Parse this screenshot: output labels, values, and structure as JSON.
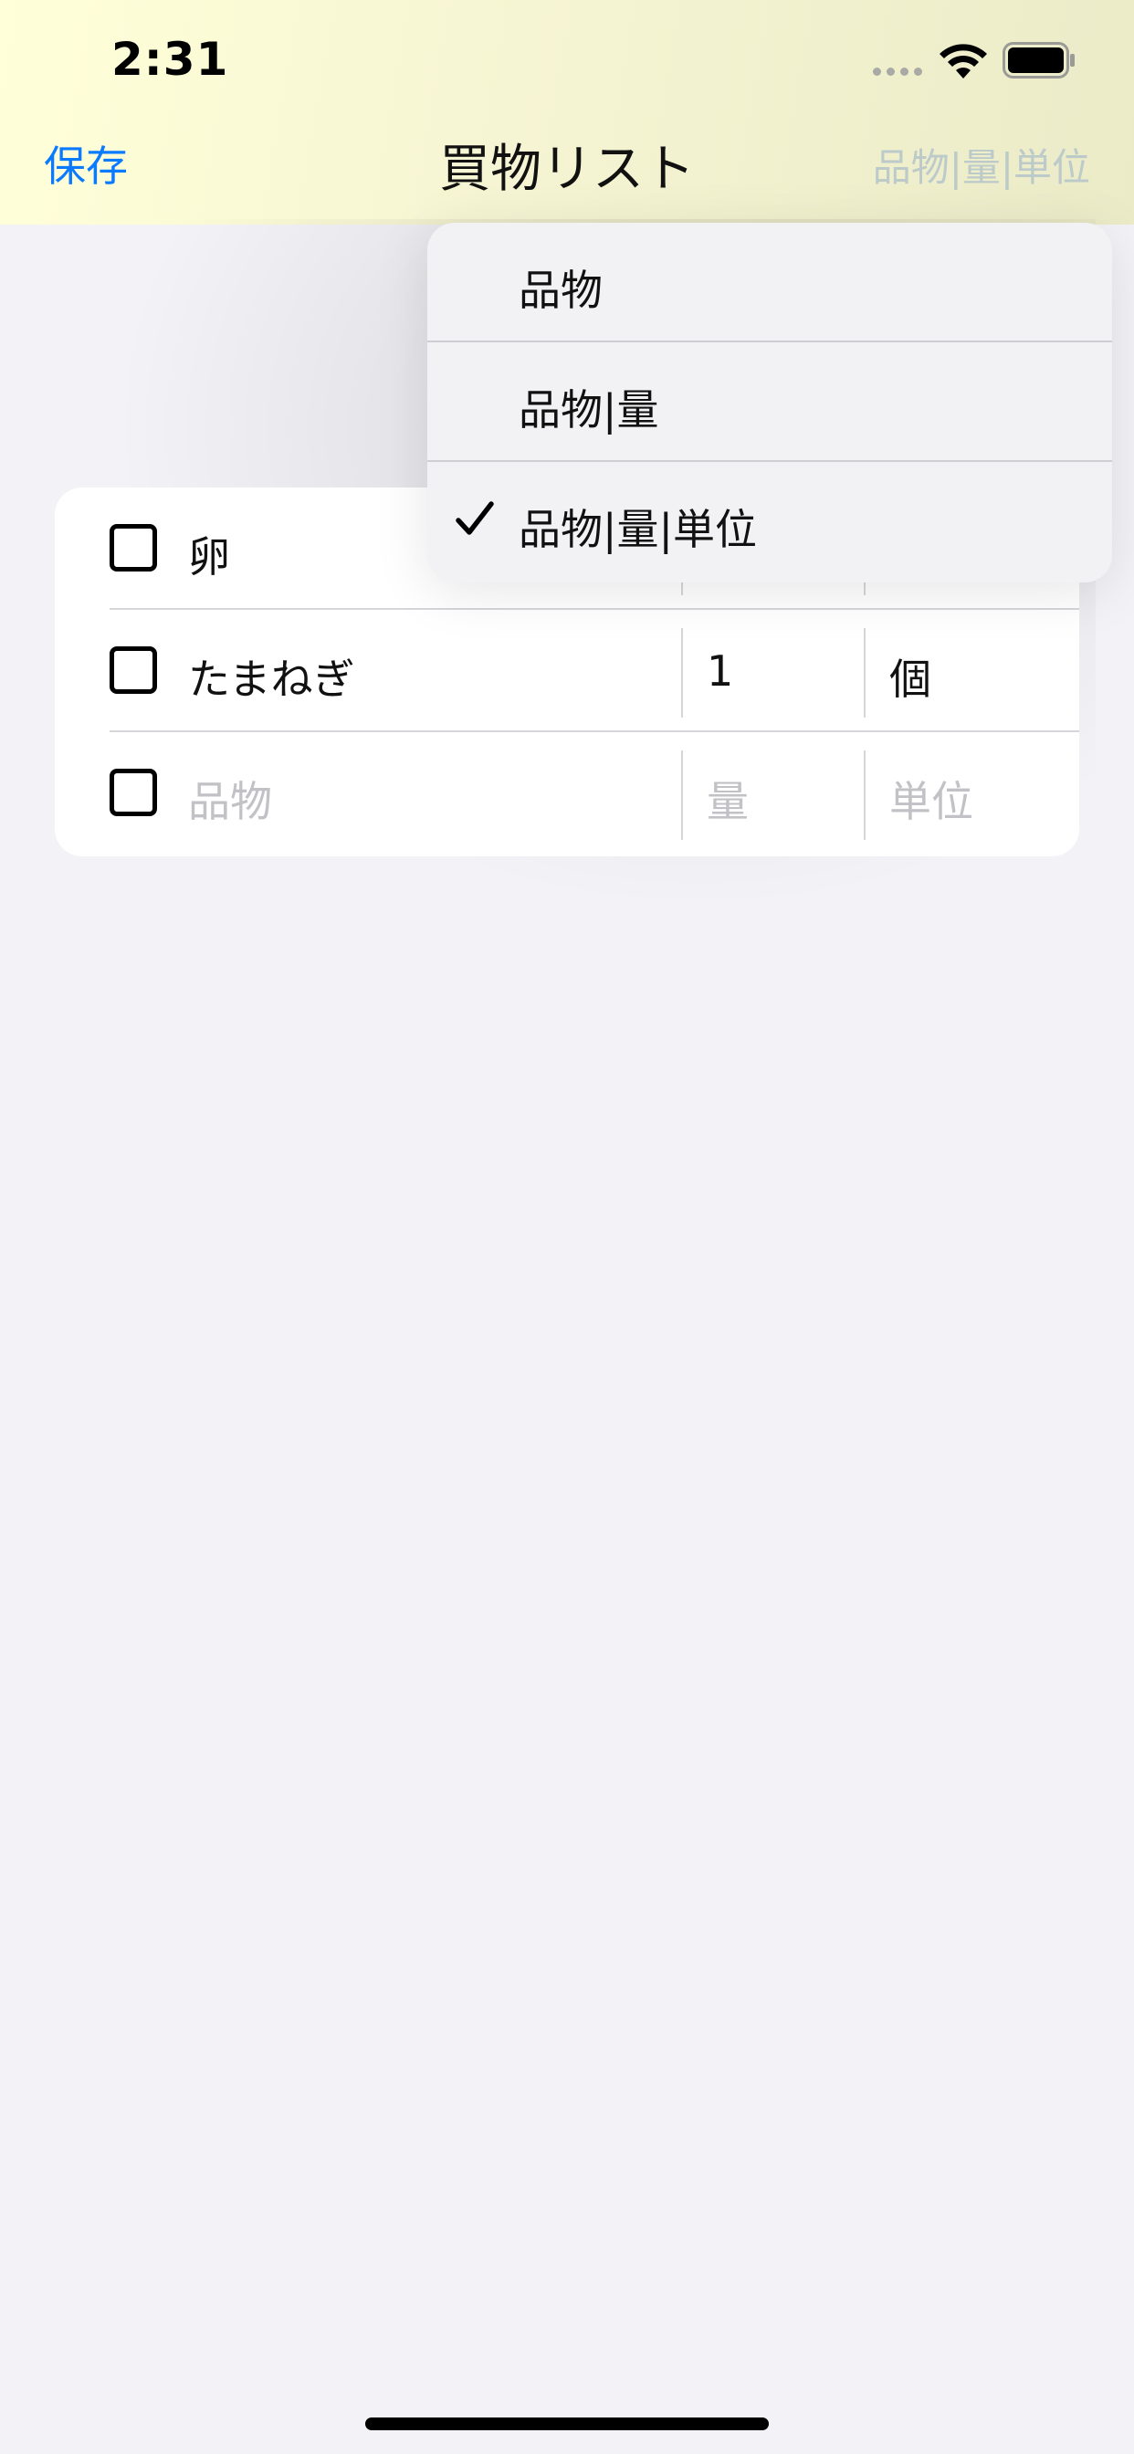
{
  "status_bar": {
    "time": "2:31",
    "icons": [
      "signal-icon",
      "wifi-icon",
      "battery-icon"
    ]
  },
  "nav": {
    "save_label": "保存",
    "title": "買物リスト",
    "right_label": "品物|量|単位"
  },
  "list": {
    "rows": [
      {
        "checked": false,
        "name": "卵",
        "qty": "",
        "unit": ""
      },
      {
        "checked": false,
        "name": "たまねぎ",
        "qty": "1",
        "unit": "個"
      }
    ],
    "new_row": {
      "name_placeholder": "品物",
      "qty_placeholder": "量",
      "unit_placeholder": "単位"
    }
  },
  "menu": {
    "items": [
      {
        "label": "品物",
        "selected": false
      },
      {
        "label": "品物|量",
        "selected": false
      },
      {
        "label": "品物|量|単位",
        "selected": true
      }
    ]
  },
  "colors": {
    "accent": "#0a7aff",
    "header_gradient_start": "#ffffd9",
    "header_gradient_end": "#ebebc8",
    "background": "#f2f2f7",
    "placeholder": "#c2c2c6"
  }
}
